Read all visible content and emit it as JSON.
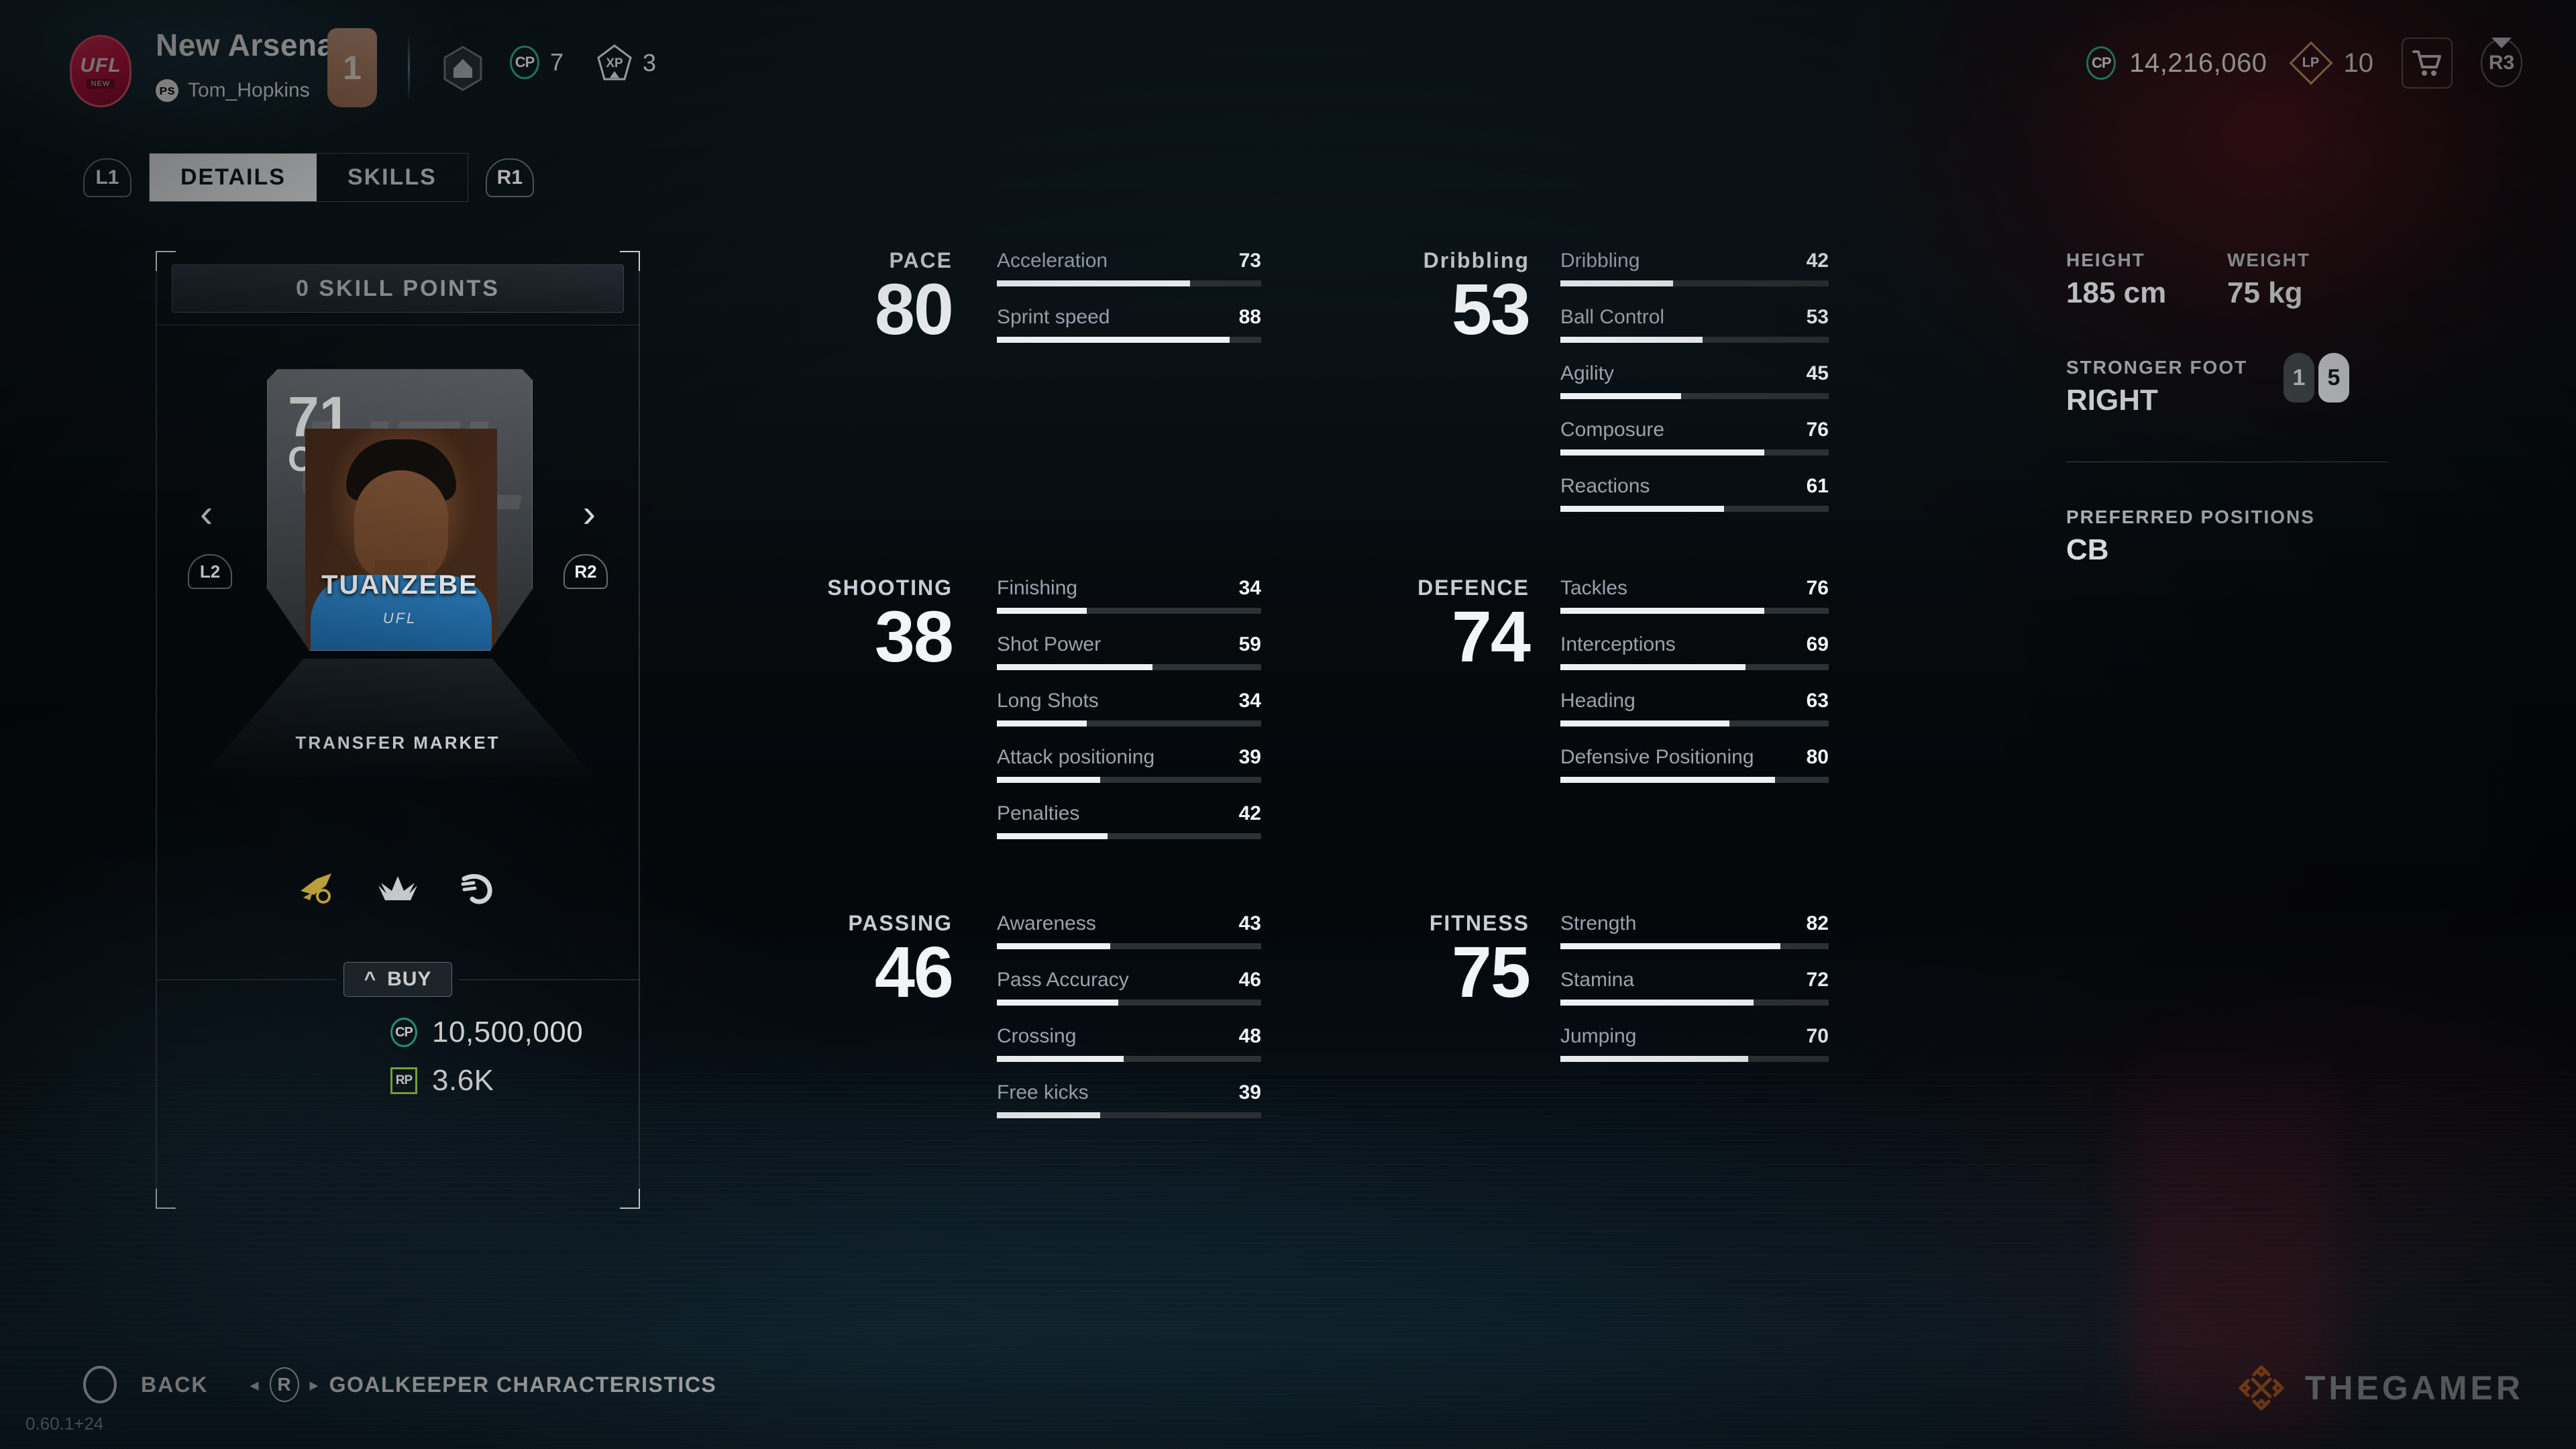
{
  "header": {
    "club_name": "New Arsenal",
    "player_tag": "Tom_Hopkins",
    "platform_icon": "playstation-icon",
    "level": "1",
    "hex_icon": "hexagon-rank-icon",
    "cp_small_label": "CP",
    "cp_small_value": "7",
    "xp_small_label": "XP",
    "xp_small_value": "3",
    "cp_label": "CP",
    "cp_value": "14,216,060",
    "lp_label": "LP",
    "lp_value": "10",
    "cart_icon": "shopping-cart-icon",
    "r3_label": "R3",
    "crest_line1": "UFL",
    "crest_line2": "NEW"
  },
  "tabs": {
    "left_bumper": "L1",
    "right_bumper": "R1",
    "items": [
      {
        "label": "DETAILS",
        "active": true
      },
      {
        "label": "SKILLS",
        "active": false
      }
    ]
  },
  "card": {
    "skill_points": "0 SKILL POINTS",
    "rating": "71",
    "position": "CB",
    "name": "TUANZEBE",
    "brand": "UFL",
    "ghost_text": "UFL",
    "prev_arrow": "‹",
    "next_arrow": "›",
    "trigger_left": "L2",
    "trigger_right": "R2",
    "transfer_market": "TRANSFER MARKET",
    "traits": [
      "speedster-plane-icon",
      "crown-wings-icon",
      "hook-curve-icon"
    ],
    "buy_label": "BUY",
    "buy_chevron": "^",
    "prices": [
      {
        "currency": "CP",
        "value": "10,500,000"
      },
      {
        "currency": "RP",
        "value": "3.6K"
      }
    ]
  },
  "stats": [
    {
      "title": "PACE",
      "total": "80",
      "rows": [
        {
          "label": "Acceleration",
          "value": 73
        },
        {
          "label": "Sprint speed",
          "value": 88
        }
      ]
    },
    {
      "title": "SHOOTING",
      "total": "38",
      "rows": [
        {
          "label": "Finishing",
          "value": 34
        },
        {
          "label": "Shot Power",
          "value": 59
        },
        {
          "label": "Long Shots",
          "value": 34
        },
        {
          "label": "Attack positioning",
          "value": 39
        },
        {
          "label": "Penalties",
          "value": 42
        }
      ]
    },
    {
      "title": "PASSING",
      "total": "46",
      "rows": [
        {
          "label": "Awareness",
          "value": 43
        },
        {
          "label": "Pass Accuracy",
          "value": 46
        },
        {
          "label": "Crossing",
          "value": 48
        },
        {
          "label": "Free kicks",
          "value": 39
        }
      ]
    },
    {
      "title": "Dribbling",
      "total": "53",
      "rows": [
        {
          "label": "Dribbling",
          "value": 42
        },
        {
          "label": "Ball Control",
          "value": 53
        },
        {
          "label": "Agility",
          "value": 45
        },
        {
          "label": "Composure",
          "value": 76
        },
        {
          "label": "Reactions",
          "value": 61
        }
      ]
    },
    {
      "title": "DEFENCE",
      "total": "74",
      "rows": [
        {
          "label": "Tackles",
          "value": 76
        },
        {
          "label": "Interceptions",
          "value": 69
        },
        {
          "label": "Heading",
          "value": 63
        },
        {
          "label": "Defensive Positioning",
          "value": 80
        }
      ]
    },
    {
      "title": "FITNESS",
      "total": "75",
      "rows": [
        {
          "label": "Strength",
          "value": 82
        },
        {
          "label": "Stamina",
          "value": 72
        },
        {
          "label": "Jumping",
          "value": 70
        }
      ]
    }
  ],
  "info": {
    "height_label": "HEIGHT",
    "height_value": "185 cm",
    "weight_label": "WEIGHT",
    "weight_value": "75 kg",
    "foot_label": "STRONGER FOOT",
    "foot_value": "RIGHT",
    "weak_foot_rating": "1",
    "strong_foot_rating": "5",
    "positions_label": "PREFERRED POSITIONS",
    "positions_value": "CB"
  },
  "footer": {
    "back_label": "BACK",
    "circle_icon": "circle-button-icon",
    "r_key": "R",
    "gk_label": "GOALKEEPER CHARACTERISTICS",
    "left_chevron": "◂",
    "right_chevron": "▸",
    "version": "0.60.1+24",
    "watermark": "THEGAMER"
  },
  "colors": {
    "accent_green": "#2fbd91",
    "accent_lime": "#9ad84a",
    "accent_peach": "#e8a980",
    "crest_red": "#d8164a",
    "watermark_orange": "#d9712a"
  }
}
